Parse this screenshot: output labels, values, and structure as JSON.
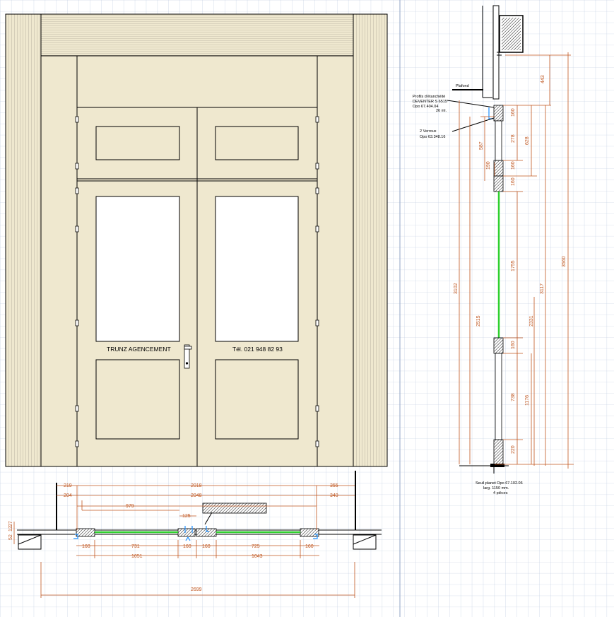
{
  "elevation": {
    "left_door_text": "TRUNZ  AGENCEMENT",
    "right_door_text": "Tél.   021 948 82 93"
  },
  "section_labels": {
    "plafond": "Plafond",
    "profile_line1": "Profils d'étanchéité",
    "profile_line2": "DEVENTER S 6515",
    "profile_line3": "Opo 67.404.04",
    "profile_line4": "26 ml.",
    "verroux_line1": "2 Verroux",
    "verroux_line2": "Opo 63.348.16",
    "seuil_line1": "Seuil planet Opo 67.102.06",
    "seuil_line2": "larg. 1150 mm.",
    "seuil_line3": "4 pièces"
  },
  "section_dims": {
    "d443": "443",
    "d160a": "160",
    "d278": "278",
    "d628": "628",
    "d587": "587",
    "d190": "190",
    "d160b": "160",
    "d160c": "160",
    "d1755": "1755",
    "d3560": "3560",
    "d3102": "3102",
    "d3117": "3117",
    "d2515": "2515",
    "d2331": "2331",
    "d160d": "160",
    "d738": "738",
    "d1176": "1176",
    "d220": "220"
  },
  "plan_dims": {
    "d219": "219",
    "d2018": "2018",
    "d355": "355",
    "d204": "204",
    "d2048": "2048",
    "d340": "340",
    "d979": "979",
    "d125": "125",
    "d160a": "160",
    "d731": "731",
    "d160b": "160",
    "d160c": "160",
    "d725": "725",
    "d160d": "160",
    "d1051": "1051",
    "d1043": "1043",
    "d2699": "2699",
    "d27": "27",
    "d52": "52",
    "d12": "12"
  }
}
